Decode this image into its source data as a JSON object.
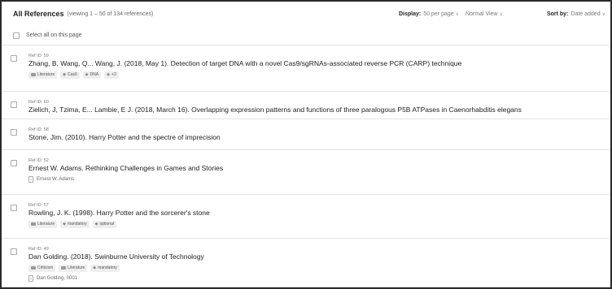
{
  "header": {
    "title": "All References",
    "viewing": "(viewing 1 – 50 of 134 references)",
    "display_label": "Display:",
    "per_page": "50 per page",
    "view_mode": "Normal View",
    "sort_label": "Sort by:",
    "sort_value": "Date added"
  },
  "select_all": {
    "label": "Select all on this page"
  },
  "references": [
    {
      "ref_id": "Ref ID: 59",
      "citation": "Zhang, B, Wang, Q... Wang, J. (2018, May 1). Detection of target DNA with a novel Cas9/sgRNAs-associated reverse PCR (CARP) technique",
      "folders": [
        "Literature"
      ],
      "tags": [
        "Cas9",
        "DNA",
        "+3"
      ],
      "attachment": ""
    },
    {
      "ref_id": "Ref ID: 60",
      "citation": "Zielich, J, Tzima, E... Lambie, E J. (2018, March 16). Overlapping expression patterns and functions of three paralogous P5B ATPases in Caenorhabditis elegans",
      "folders": [],
      "tags": [],
      "attachment": ""
    },
    {
      "ref_id": "Ref ID: 58",
      "citation": "Stone, Jim. (2010). Harry Potter and the spectre of imprecision",
      "folders": [],
      "tags": [],
      "attachment": ""
    },
    {
      "ref_id": "Ref ID: 52",
      "citation": "Ernest W. Adams. Rethinking Challenges in Games and Stories",
      "folders": [],
      "tags": [],
      "attachment": "Ernest W. Adams"
    },
    {
      "ref_id": "Ref ID: 57",
      "citation": "Rowling, J. K. (1998). Harry Potter and the sorcerer's stone",
      "folders": [
        "Literature"
      ],
      "tags": [
        "mandatory",
        "optional"
      ],
      "attachment": ""
    },
    {
      "ref_id": "Ref ID: 49",
      "citation": "Dan Golding. (2018). Swinburne University of Technology",
      "folders": [
        "Criticism",
        "Literature"
      ],
      "tags": [
        "mandatory"
      ],
      "attachment": "Dan Golding, 0001"
    }
  ]
}
